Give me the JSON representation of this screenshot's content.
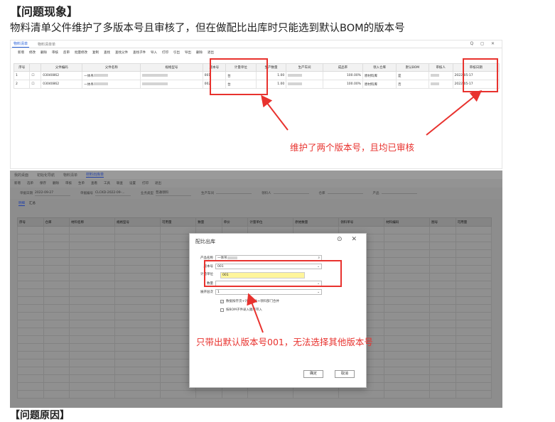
{
  "doc": {
    "heading": "【问题现象】",
    "description": "物料清单父件维护了多版本号且审核了，但在做配比出库时只能选到默认BOM的版本号",
    "next_heading": "【问题原因】"
  },
  "screen1": {
    "tabs": [
      "物料清单",
      "物料清单单"
    ],
    "window_controls": "Q ◻ ✕",
    "toolbar": [
      "新增",
      "修改",
      "删除",
      "审核",
      "反审",
      "批量修改",
      "复制",
      "查找",
      "查找父件",
      "查找子件",
      "导入",
      "打印",
      "引出",
      "导出",
      "删除",
      "退出"
    ],
    "columns": [
      "序号",
      "",
      "父件编码",
      "父件名称",
      "规格型号",
      "版本号",
      "计量单位",
      "生产数量",
      "生产车间",
      "成品率",
      "领入仓库",
      "默认BOM",
      "审核人",
      "审核日期"
    ],
    "rows": [
      {
        "seq": "1",
        "code": "03040862",
        "name": "一体吊",
        "version": "001",
        "unit": "台",
        "qty": "1.00",
        "yield": "100.00%",
        "warehouse": "原材料库",
        "default_bom": "是",
        "date": "2022-05-17"
      },
      {
        "seq": "2",
        "code": "03040862",
        "name": "一体吊",
        "version": "002",
        "unit": "台",
        "qty": "1.00",
        "yield": "100.00%",
        "warehouse": "原材料库",
        "default_bom": "否",
        "date": "2022-05-17"
      }
    ],
    "annotation": "维护了两个版本号，且均已审核"
  },
  "screen2": {
    "tabs": [
      "我的桌面",
      "初始化导航",
      "物料清单",
      "材料出库单"
    ],
    "toolbar": [
      "新增",
      "选单",
      "保存",
      "删除",
      "审核",
      "生单",
      "查看",
      "工具",
      "联查",
      "设置",
      "打印",
      "退出"
    ],
    "form": [
      {
        "label": "单据日期",
        "value": "2022-09-27"
      },
      {
        "label": "单据编号",
        "value": "CLCKD-2022-09-..."
      },
      {
        "label": "业务类型",
        "value": "普通领料"
      },
      {
        "label": "生产车间",
        "value": ""
      },
      {
        "label": "领料人",
        "value": ""
      },
      {
        "label": "仓库",
        "value": ""
      },
      {
        "label": "产品",
        "value": ""
      }
    ],
    "subtabs": [
      "明细",
      "汇总"
    ],
    "columns": [
      "序号",
      "仓库",
      "材料名称",
      "规格型号",
      "可用量",
      "数量",
      "单价",
      "计量单位",
      "原始数量",
      "领料单号",
      "材料编码",
      "图号",
      "可用量"
    ],
    "dialog": {
      "title": "配比出库",
      "icons": "⊙ ✕",
      "product_label": "产品名称",
      "product_value": "一体吊",
      "version_label": "版本号",
      "version_value": "001",
      "unit_label": "计量单位",
      "option": "001",
      "qty_label": "数量",
      "expand_label": "展开层次",
      "expand_value": "1",
      "check1": "数据按存货+计量单位+领料部门合并",
      "check2": "按BOM子件录入顺序带入",
      "ok": "确定",
      "cancel": "取消"
    },
    "annotation": "只带出默认版本号001，无法选择其他版本号"
  }
}
